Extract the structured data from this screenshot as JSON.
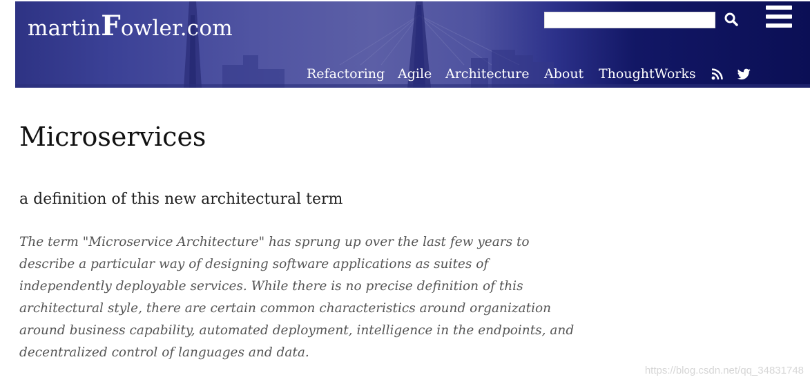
{
  "header": {
    "logo": {
      "part1": "martin",
      "part2": "F",
      "part3": "owler.com"
    },
    "search": {
      "value": "",
      "placeholder": ""
    },
    "icons": {
      "search": "search-icon",
      "menu": "hamburger-menu-icon",
      "rss": "rss-icon",
      "twitter": "twitter-icon"
    },
    "nav": [
      {
        "label": "Refactoring"
      },
      {
        "label": "Agile"
      },
      {
        "label": "Architecture"
      },
      {
        "label": "About"
      },
      {
        "label": "ThoughtWorks"
      }
    ],
    "colors": {
      "banner_dark": "#0b0f55",
      "banner_light": "#5c5fa6"
    }
  },
  "main": {
    "title": "Microservices",
    "subtitle": "a definition of this new architectural term",
    "abstract": "The term \"Microservice Architecture\" has sprung up over the last few years to describe a particular way of designing software applications as suites of independently deployable services. While there is no precise definition of this architectural style, there are certain common characteristics around organization around business capability, automated deployment, intelligence in the endpoints, and decentralized control of languages and data."
  },
  "watermark": "https://blog.csdn.net/qq_34831748"
}
